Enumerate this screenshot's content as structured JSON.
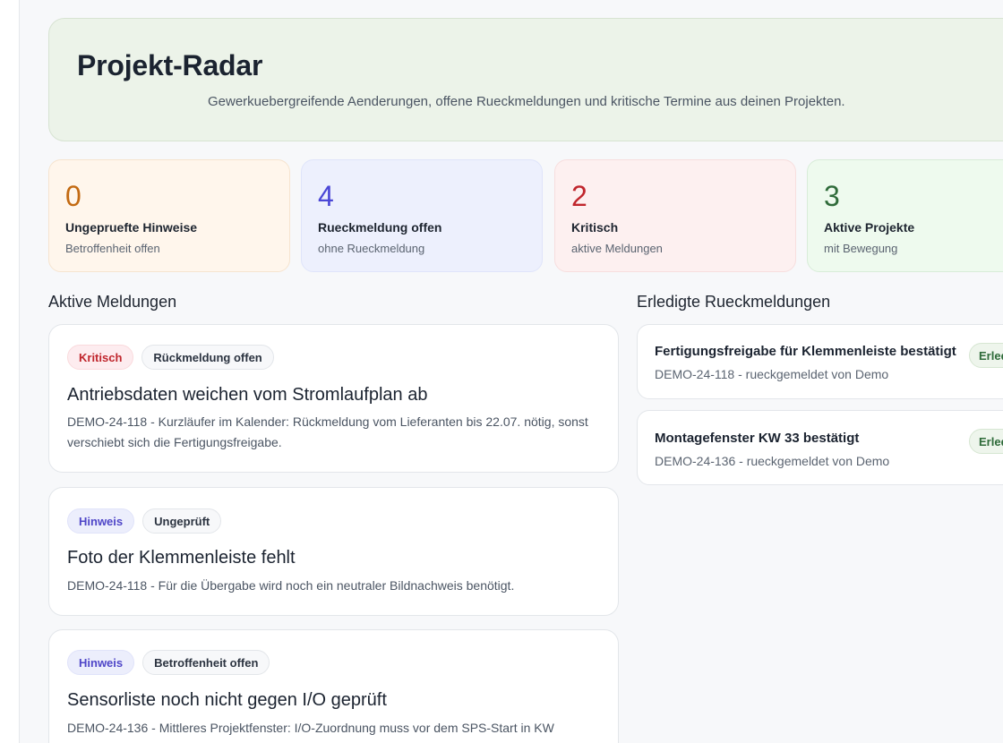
{
  "hero": {
    "title": "Projekt-Radar",
    "subtitle": "Gewerkuebergreifende Aenderungen, offene Rueckmeldungen und kritische Termine aus deinen Projekten."
  },
  "stats": [
    {
      "value": "0",
      "label": "Ungepruefte Hinweise",
      "sub": "Betroffenheit offen",
      "color": "#c36a12"
    },
    {
      "value": "4",
      "label": "Rueckmeldung offen",
      "sub": "ohne Rueckmeldung",
      "color": "#4b47d6"
    },
    {
      "value": "2",
      "label": "Kritisch",
      "sub": "aktive Meldungen",
      "color": "#c0262d"
    },
    {
      "value": "3",
      "label": "Aktive Projekte",
      "sub": "mit Bewegung",
      "color": "#2f6b3a"
    }
  ],
  "sections": {
    "active_heading": "Aktive Meldungen",
    "done_heading": "Erledigte Rueckmeldungen"
  },
  "alerts": [
    {
      "badges": [
        "Kritisch",
        "Rückmeldung offen"
      ],
      "title": "Antriebsdaten weichen vom Stromlaufplan ab",
      "description": "DEMO-24-118 - Kurzläufer im Kalender: Rückmeldung vom Lieferanten bis 22.07. nötig, sonst verschiebt sich die Fertigungsfreigabe."
    },
    {
      "badges": [
        "Hinweis",
        "Ungeprüft"
      ],
      "title": "Foto der Klemmenleiste fehlt",
      "description": "DEMO-24-118 - Für die Übergabe wird noch ein neutraler Bildnachweis benötigt."
    },
    {
      "badges": [
        "Hinweis",
        "Betroffenheit offen"
      ],
      "title": "Sensorliste noch nicht gegen I/O geprüft",
      "description": "DEMO-24-136 - Mittleres Projektfenster: I/O-Zuordnung muss vor dem SPS-Start in KW"
    }
  ],
  "done": [
    {
      "title": "Fertigungsfreigabe für Klemmenleiste bestätigt",
      "meta": "DEMO-24-118 - rueckgemeldet von Demo",
      "badge": "Erledigt"
    },
    {
      "title": "Montagefenster KW 33 bestätigt",
      "meta": "DEMO-24-136 - rueckgemeldet von Demo",
      "badge": "Erledigt"
    }
  ]
}
